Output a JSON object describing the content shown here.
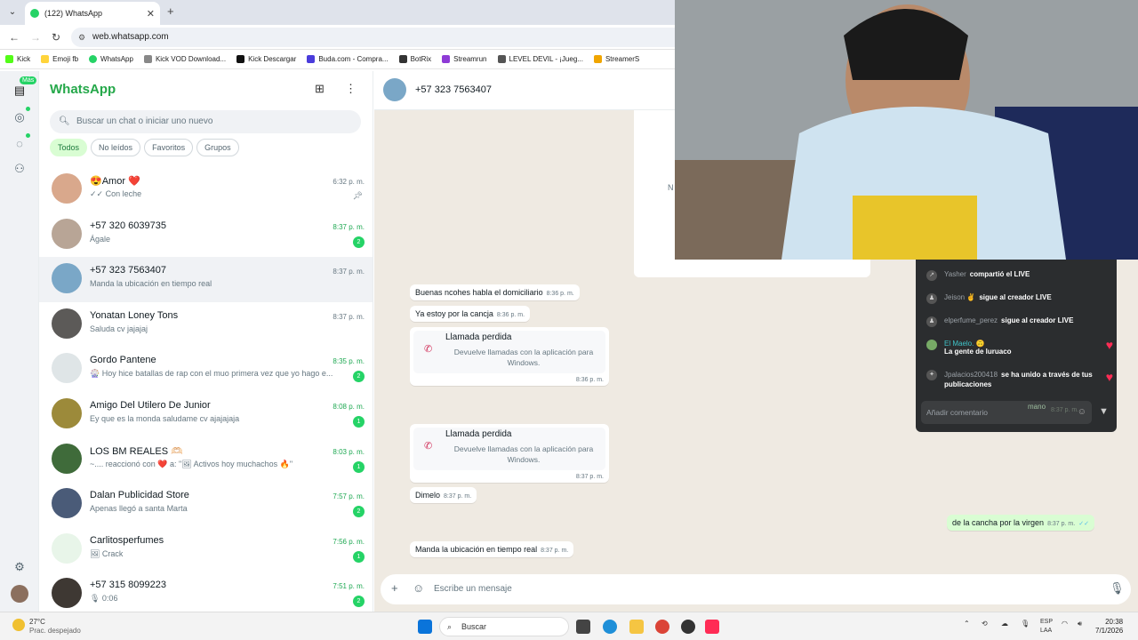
{
  "browser": {
    "tab_title": "(122) WhatsApp",
    "url": "web.whatsapp.com",
    "bookmarks": [
      "Kick",
      "Emoji fb",
      "WhatsApp",
      "Kick VOD Download...",
      "Kick Descargar",
      "Buda.com - Compra...",
      "BotRix",
      "Streamrun",
      "LEVEL DEVIL - ¡Jueg...",
      "StreamerS"
    ]
  },
  "rail": {
    "mas_badge": "Más"
  },
  "sidebar": {
    "brand": "WhatsApp",
    "search_placeholder": "Buscar un chat o iniciar uno nuevo",
    "filters": [
      "Todos",
      "No leídos",
      "Favoritos",
      "Grupos"
    ],
    "chats": [
      {
        "name": "😍Amor ❤️",
        "msg": "✓✓ Con leche",
        "time": "6:32 p. m.",
        "badge": "",
        "unread": false,
        "pinned": true,
        "color": "#d9a88c"
      },
      {
        "name": "+57 320 6039735",
        "msg": "Ágale",
        "time": "8:37 p. m.",
        "badge": "2",
        "unread": true,
        "color": "#b8a596"
      },
      {
        "name": "+57 323 7563407",
        "msg": "Manda la ubicación en tiempo real",
        "time": "8:37 p. m.",
        "badge": "",
        "unread": false,
        "color": "#7aa7c7"
      },
      {
        "name": "Yonatan Loney Tons",
        "msg": "Saluda cv jajajaj",
        "time": "8:37 p. m.",
        "badge": "",
        "unread": false,
        "color": "#5c5a58"
      },
      {
        "name": "Gordo Pantene",
        "msg": "🎡 Hoy hice batallas de rap con el muo primera vez que yo hago e...",
        "time": "8:35 p. m.",
        "badge": "2",
        "unread": true,
        "color": "#dfe5e7"
      },
      {
        "name": "Amigo Del Utilero De Junior",
        "msg": "Ey que es la monda saludame cv ajajajaja",
        "time": "8:08 p. m.",
        "badge": "1",
        "unread": true,
        "color": "#9c8a3a"
      },
      {
        "name": "LOS BM REALES 🫶🏻",
        "msg": "~.... reaccionó con ❤️ a: \"🖼 Activos hoy muchachos 🔥\"",
        "time": "8:03 p. m.",
        "badge": "1",
        "unread": true,
        "color": "#3f6b3a"
      },
      {
        "name": "Dalan Publicidad Store",
        "msg": "Apenas llegó a santa Marta",
        "time": "7:57 p. m.",
        "badge": "2",
        "unread": true,
        "color": "#4a5b78"
      },
      {
        "name": "Carlitosperfumes",
        "msg": "🖼 Crack",
        "time": "7:56 p. m.",
        "badge": "1",
        "unread": true,
        "color": "#e8f5e9"
      },
      {
        "name": "+57 315 8099223",
        "msg": "🎙 0:06",
        "time": "7:51 p. m.",
        "badge": "2",
        "unread": true,
        "color": "#3e3833"
      }
    ]
  },
  "chat": {
    "contact": "+57 323 7563407",
    "card_partial": "N",
    "messages": [
      {
        "text": "Buenas ncohes habla el domiciliario",
        "time": "8:36 p. m."
      },
      {
        "text": "Ya estoy por la cancja",
        "time": "8:36 p. m."
      },
      {
        "text": "Dimelo",
        "time": "8:37 p. m."
      },
      {
        "text": "Manda la ubicación en tiempo real",
        "time": "8:37 p. m."
      }
    ],
    "missed_calls": [
      {
        "title": "Llamada perdida",
        "sub": "Devuelve llamadas con la aplicación para Windows.",
        "time": "8:36 p. m."
      },
      {
        "title": "Llamada perdida",
        "sub": "Devuelve llamadas con la aplicación para Windows.",
        "time": "8:37 p. m."
      }
    ],
    "outgoing": {
      "text": "de la cancha por la virgen",
      "time": "8:37 p. m.",
      "ticks": "✓✓"
    },
    "composer_placeholder": "Escribe un mensaje"
  },
  "live": {
    "events": [
      {
        "user": "Yasher",
        "action": "compartió el LIVE"
      },
      {
        "user": "Jeison ✌",
        "action": "sigue al creador LIVE"
      },
      {
        "user": "elperfume_perez",
        "action": "sigue al creador LIVE"
      },
      {
        "user": "El Maelo. 🙃",
        "action": "La gente de luruaco"
      },
      {
        "user": "Jpalacios200418",
        "action": "se ha unido a través de tus publicaciones"
      }
    ],
    "comment_placeholder": "Añadir comentario",
    "ghost_text": "mano",
    "ghost_time": "8:37 p. m."
  },
  "taskbar": {
    "temp": "27°C",
    "weather": "Prac. despejado",
    "search": "Buscar",
    "lang1": "ESP",
    "lang2": "LAA",
    "time": "20:38",
    "date": "7/1/2026"
  }
}
